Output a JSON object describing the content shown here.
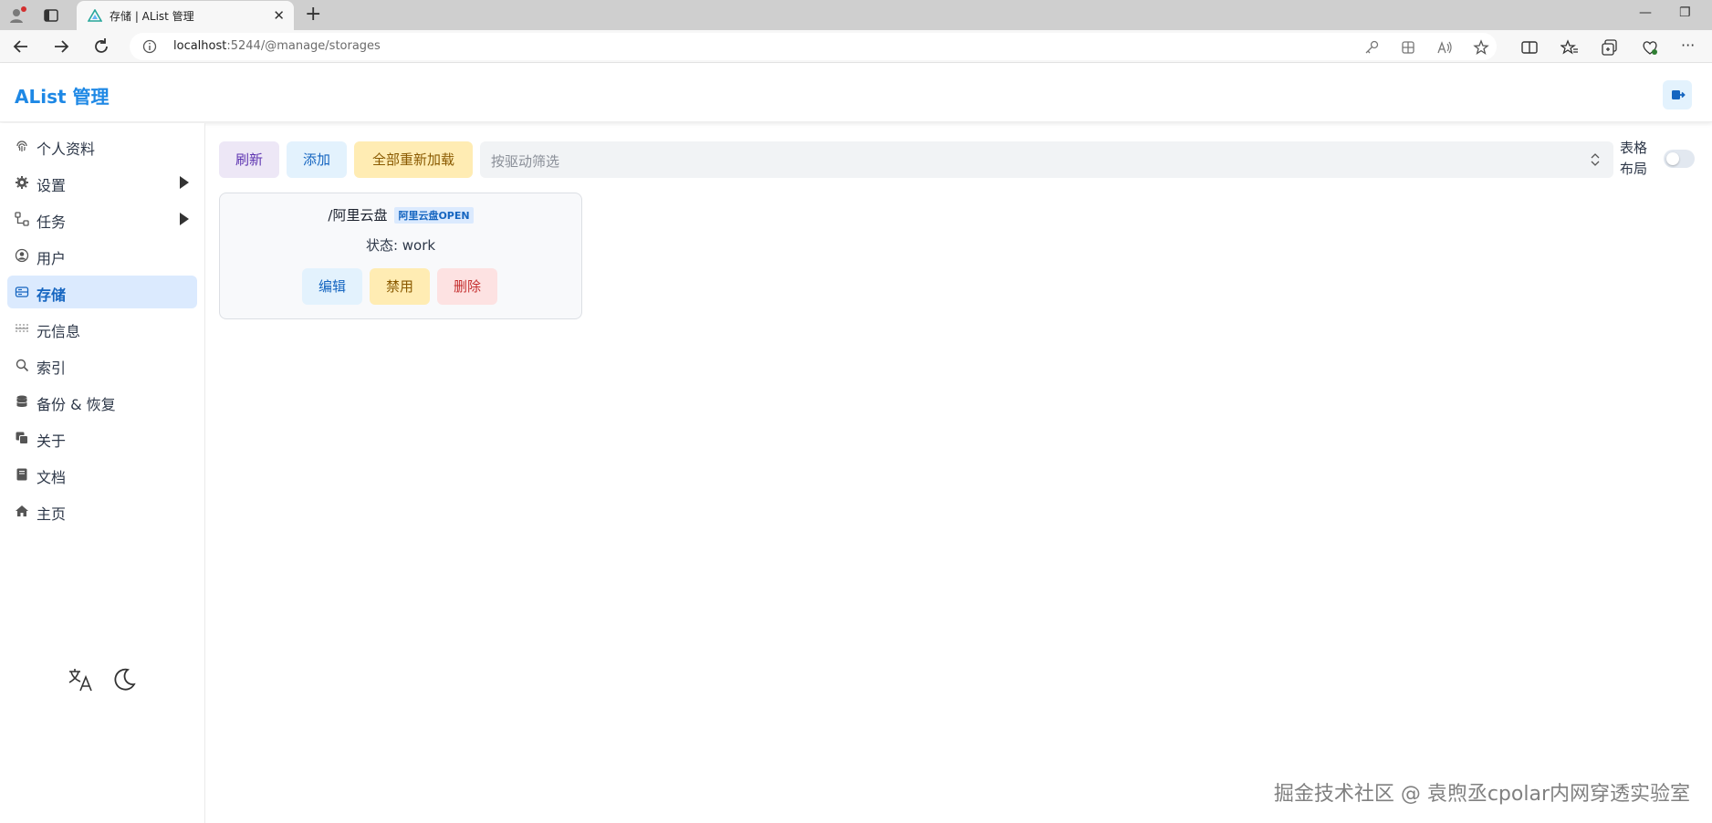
{
  "browser": {
    "tab_title": "存储 | AList 管理",
    "url_host": "localhost",
    "url_rest": ":5244/@manage/storages"
  },
  "header": {
    "title": "AList 管理"
  },
  "sidebar": {
    "items": [
      {
        "label": "个人资料",
        "icon": "fingerprint-icon"
      },
      {
        "label": "设置",
        "icon": "gear-icon"
      },
      {
        "label": "任务",
        "icon": "flow-icon"
      },
      {
        "label": "用户",
        "icon": "user-circle-icon"
      },
      {
        "label": "存储",
        "icon": "storage-icon"
      },
      {
        "label": "元信息",
        "icon": "meta-icon"
      },
      {
        "label": "索引",
        "icon": "search-icon"
      },
      {
        "label": "备份 & 恢复",
        "icon": "database-icon"
      },
      {
        "label": "关于",
        "icon": "copy-icon"
      },
      {
        "label": "文档",
        "icon": "book-icon"
      },
      {
        "label": "主页",
        "icon": "home-icon"
      }
    ]
  },
  "main": {
    "refresh_label": "刷新",
    "add_label": "添加",
    "reload_all_label": "全部重新加载",
    "filter_placeholder": "按驱动筛选",
    "table_layout_label": "表格布局",
    "table_layout_on": false,
    "storage": {
      "mount_path": "/阿里云盘",
      "driver": "阿里云盘OPEN",
      "status": "状态: work",
      "edit_label": "编辑",
      "disable_label": "禁用",
      "delete_label": "删除"
    }
  },
  "watermark": "掘金技术社区 @ 袁煦丞cpolar内网穿透实验室",
  "colors": {
    "accent": "#1e88e5",
    "active_bg": "#dbeafe"
  }
}
